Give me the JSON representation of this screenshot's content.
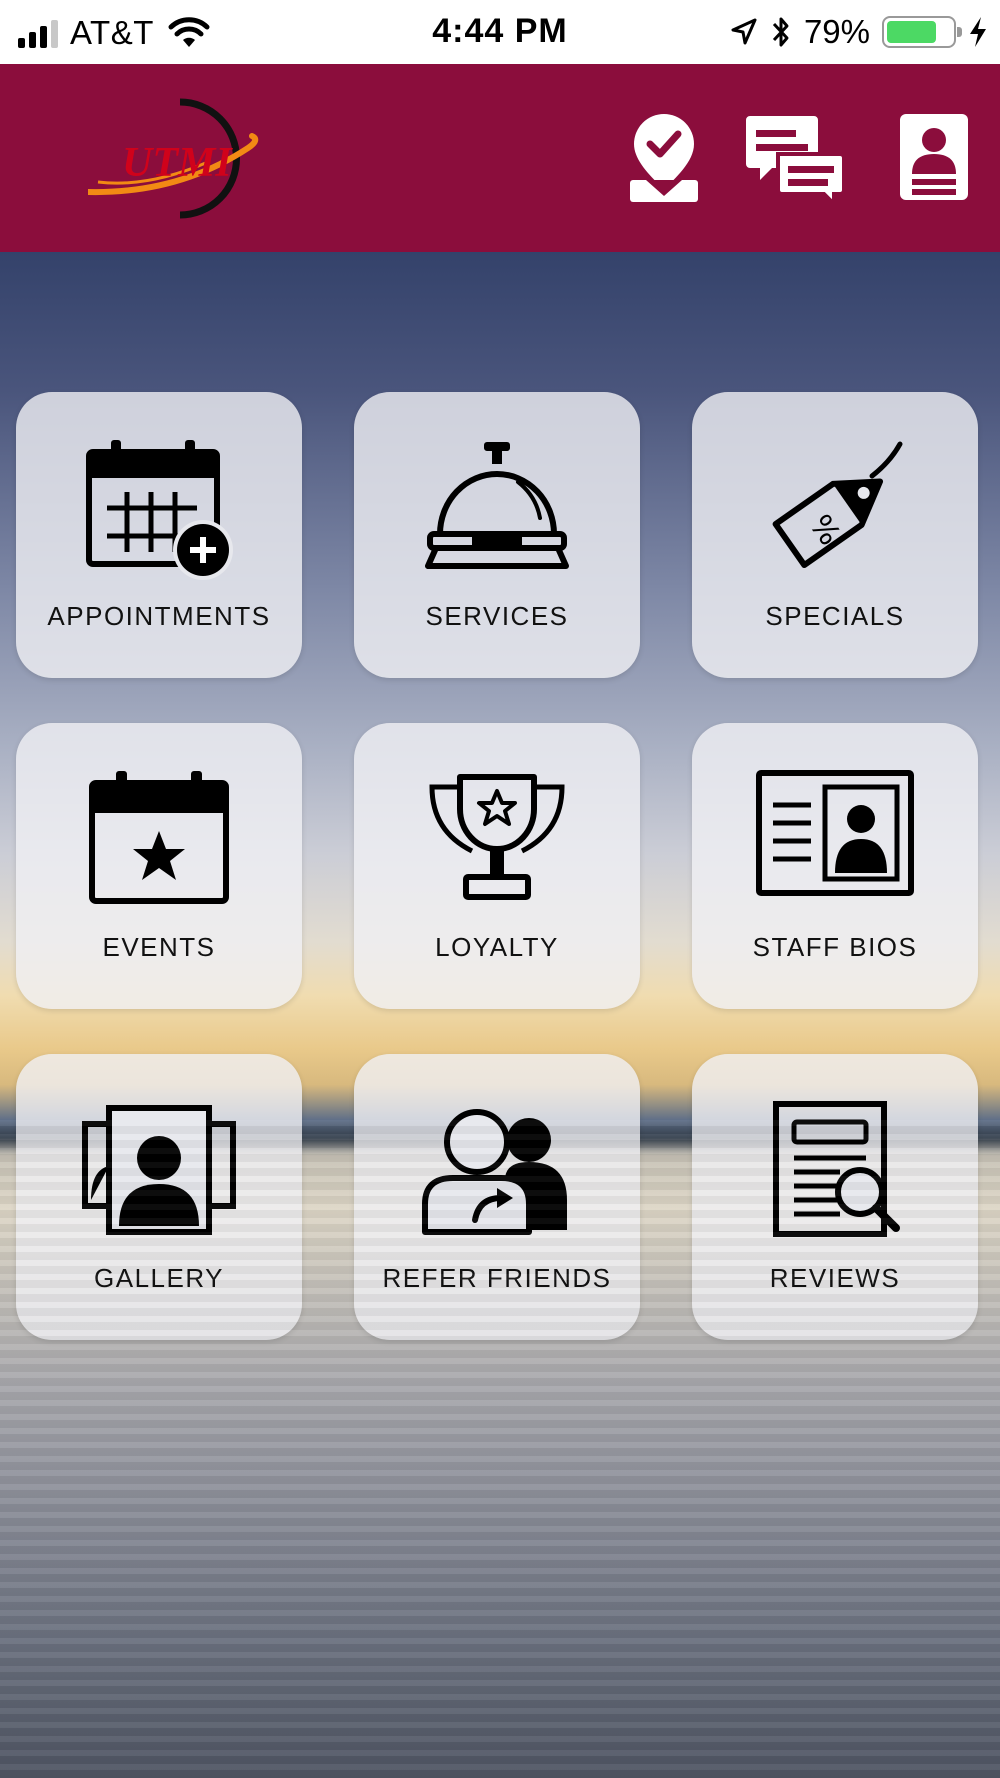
{
  "status_bar": {
    "carrier": "AT&T",
    "time": "4:44 PM",
    "battery_percent": "79%",
    "battery_level": 0.79,
    "icons": [
      "signal-icon",
      "wifi-icon",
      "location-arrow-icon",
      "bluetooth-icon",
      "battery-icon",
      "charging-bolt-icon"
    ]
  },
  "header": {
    "background_color": "#8b0d3c",
    "logo_text": "UTMI",
    "actions": [
      "check-in-icon",
      "messages-icon",
      "profile-icon"
    ]
  },
  "tiles": [
    {
      "label": "APPOINTMENTS",
      "icon": "calendar-add-icon"
    },
    {
      "label": "SERVICES",
      "icon": "service-bell-icon"
    },
    {
      "label": "SPECIALS",
      "icon": "discount-tag-icon"
    },
    {
      "label": "EVENTS",
      "icon": "calendar-star-icon"
    },
    {
      "label": "LOYALTY",
      "icon": "trophy-icon"
    },
    {
      "label": "STAFF BIOS",
      "icon": "id-card-icon"
    },
    {
      "label": "GALLERY",
      "icon": "gallery-icon"
    },
    {
      "label": "REFER FRIENDS",
      "icon": "refer-friends-icon"
    },
    {
      "label": "REVIEWS",
      "icon": "reviews-icon"
    }
  ]
}
